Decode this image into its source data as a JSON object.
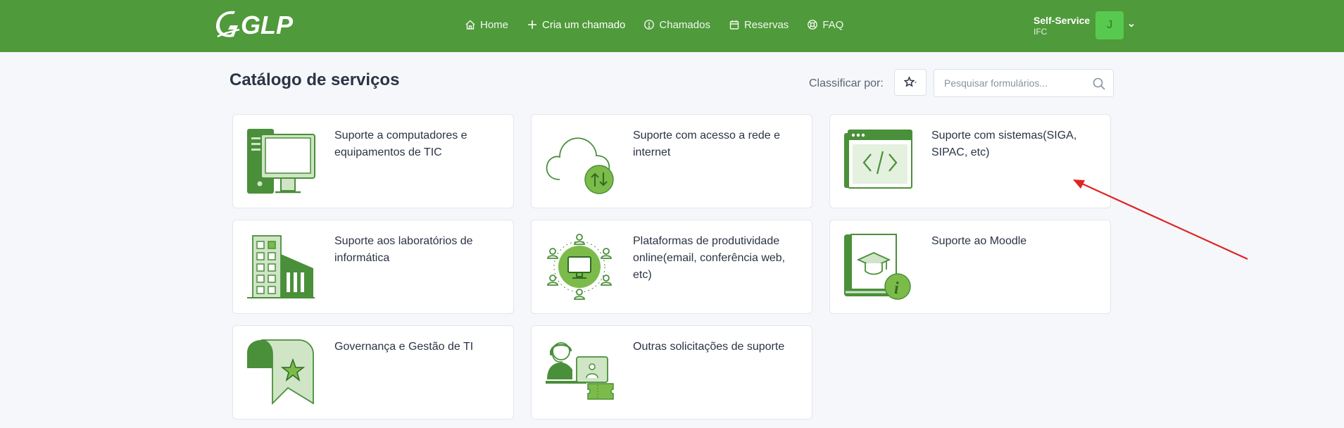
{
  "brand": {
    "logo_text": "GLPI"
  },
  "nav": {
    "items": [
      {
        "label": "Home",
        "icon": "home-icon"
      },
      {
        "label": "Cria um chamado",
        "icon": "plus-icon"
      },
      {
        "label": "Chamados",
        "icon": "alert-circle-icon"
      },
      {
        "label": "Reservas",
        "icon": "calendar-icon"
      },
      {
        "label": "FAQ",
        "icon": "lifebuoy-icon"
      }
    ]
  },
  "user": {
    "profile": "Self-Service",
    "entity": "IFC",
    "initial": "J"
  },
  "page": {
    "title": "Catálogo de serviços",
    "sort_label": "Classificar por:",
    "search_placeholder": "Pesquisar formulários..."
  },
  "catalog": [
    {
      "label": "Suporte a computadores e equipamentos de TIC",
      "icon": "computer-icon"
    },
    {
      "label": "Suporte com acesso a rede e internet",
      "icon": "cloud-network-icon"
    },
    {
      "label": "Suporte com sistemas(SIGA, SIPAC, etc)",
      "icon": "code-window-icon"
    },
    {
      "label": "Suporte aos laboratórios de informática",
      "icon": "building-icon"
    },
    {
      "label": "Plataformas de produtividade online(email, conferência web, etc)",
      "icon": "online-platform-icon"
    },
    {
      "label": "Suporte ao Moodle",
      "icon": "moodle-book-icon"
    },
    {
      "label": "Governança e Gestão de TI",
      "icon": "bookmark-star-icon"
    },
    {
      "label": "Outras solicitações de suporte",
      "icon": "support-agent-icon"
    }
  ],
  "colors": {
    "header_bg": "#4f9a3a",
    "icon_dark": "#4a8f3a",
    "icon_light": "#cfe5c6",
    "icon_mid": "#7cbb4a",
    "annotation_arrow": "#e02424"
  }
}
